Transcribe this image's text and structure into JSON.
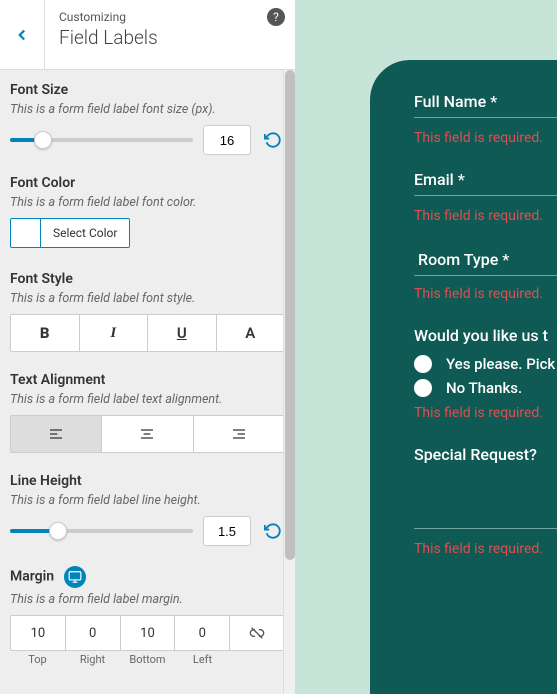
{
  "header": {
    "sub": "Customizing",
    "main": "Field Labels"
  },
  "fontSize": {
    "title": "Font Size",
    "desc": "This is a form field label font size (px).",
    "value": "16",
    "percent": 18
  },
  "fontColor": {
    "title": "Font Color",
    "desc": "This is a form field label font color.",
    "button": "Select Color"
  },
  "fontStyle": {
    "title": "Font Style",
    "desc": "This is a form field label font style."
  },
  "textAlign": {
    "title": "Text Alignment",
    "desc": "This is a form field label text alignment."
  },
  "lineHeight": {
    "title": "Line Height",
    "desc": "This is a form field label line height.",
    "value": "1.5",
    "percent": 26
  },
  "margin": {
    "title": "Margin",
    "desc": "This is a form field label margin.",
    "top": "10",
    "right": "0",
    "bottom": "10",
    "left": "0",
    "labels": {
      "top": "Top",
      "right": "Right",
      "bottom": "Bottom",
      "left": "Left"
    }
  },
  "preview": {
    "fields": {
      "fullName": "Full Name *",
      "email": "Email *",
      "roomType": "Room Type *",
      "pickup": "Would you like us t",
      "special": "Special Request?"
    },
    "options": {
      "yes": "Yes please. Pick",
      "no": "No Thanks."
    },
    "error": "This field is required."
  }
}
